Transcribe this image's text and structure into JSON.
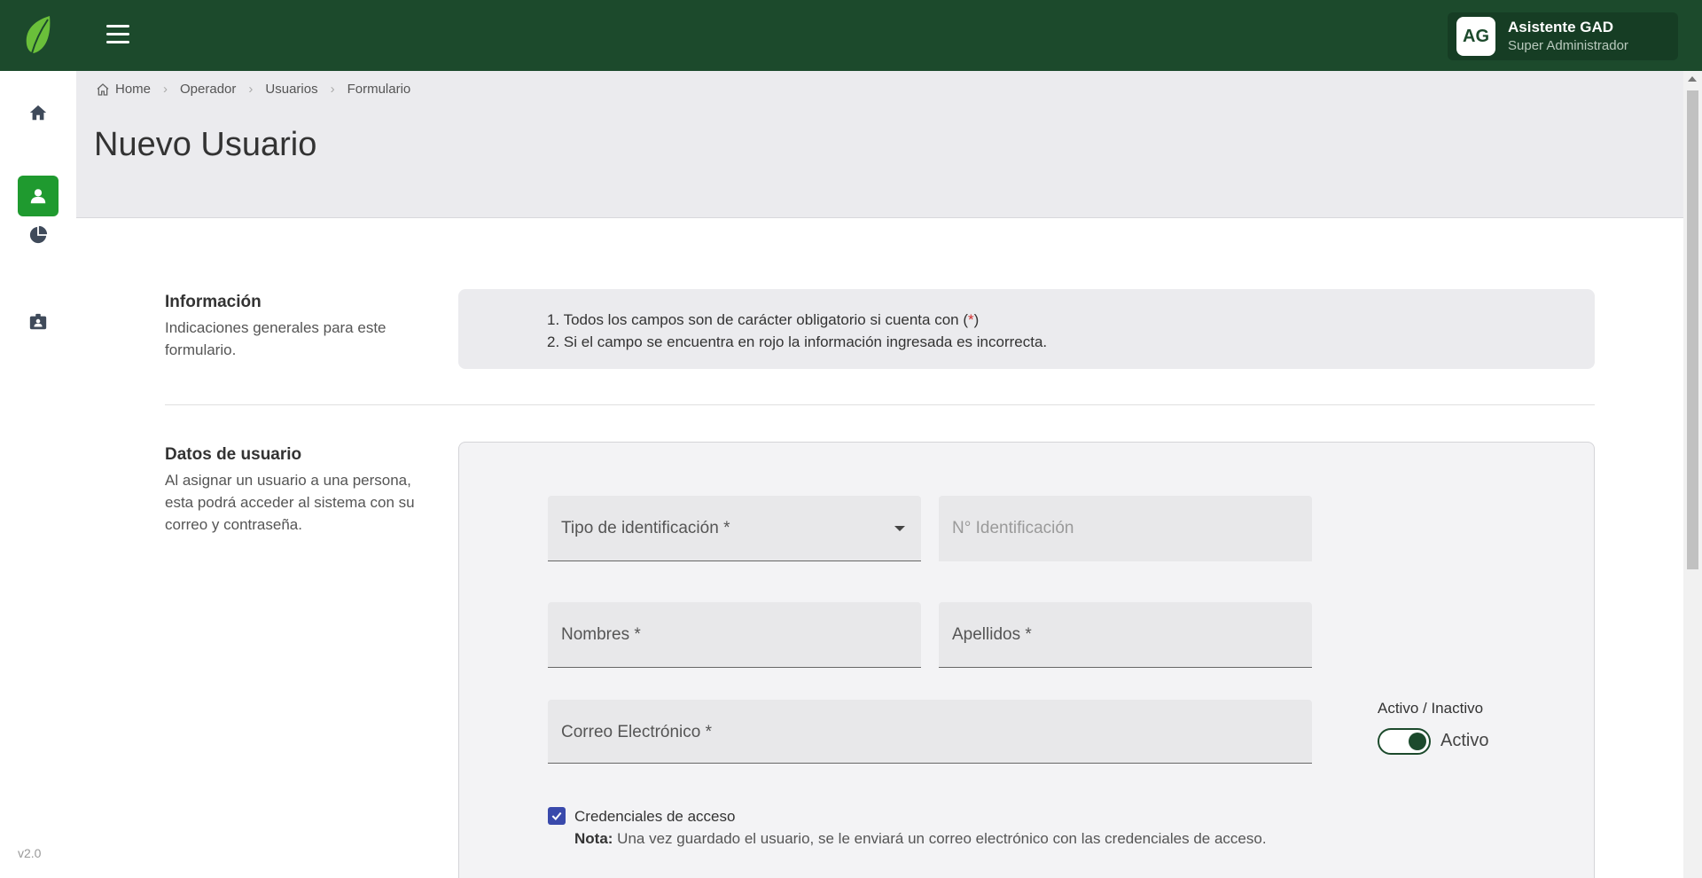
{
  "topbar": {
    "user": {
      "initials": "AG",
      "name": "Asistente GAD",
      "role": "Super Administrador"
    }
  },
  "sidebar": {
    "items": [
      {
        "icon": "home-icon"
      },
      {
        "icon": "user-icon",
        "active": true
      },
      {
        "icon": "pie-chart-icon"
      },
      {
        "icon": "id-badge-icon"
      }
    ],
    "version": "v2.0"
  },
  "breadcrumb": [
    "Home",
    "Operador",
    "Usuarios",
    "Formulario"
  ],
  "page": {
    "title": "Nuevo Usuario"
  },
  "info_section": {
    "title": "Información",
    "description": "Indicaciones generales para este formulario.",
    "line1_prefix": "1. Todos los campos son de carácter obligatorio si cuenta con (",
    "line1_mark": "*",
    "line1_suffix": ")",
    "line2": "2. Si el campo se encuentra en rojo la información ingresada es incorrecta."
  },
  "user_section": {
    "title": "Datos de usuario",
    "description": "Al asignar un usuario a una persona, esta podrá acceder al sistema con su correo y contraseña."
  },
  "form": {
    "id_type_label": "Tipo de identificación *",
    "id_number_placeholder": "N° Identificación",
    "first_names_label": "Nombres *",
    "last_names_label": "Apellidos *",
    "email_label": "Correo Electrónico *",
    "status_label": "Activo / Inactivo",
    "status_value": "Activo",
    "credentials_label": "Credenciales de acceso",
    "note_prefix": "Nota:",
    "note_text": " Una vez guardado el usuario, se le enviará un correo electrónico con las credenciales de acceso."
  },
  "colors": {
    "topbar": "#1c4a2c",
    "active_nav": "#1f9a2f",
    "checkbox": "#3949ab",
    "required_mark": "#d32f2f"
  }
}
